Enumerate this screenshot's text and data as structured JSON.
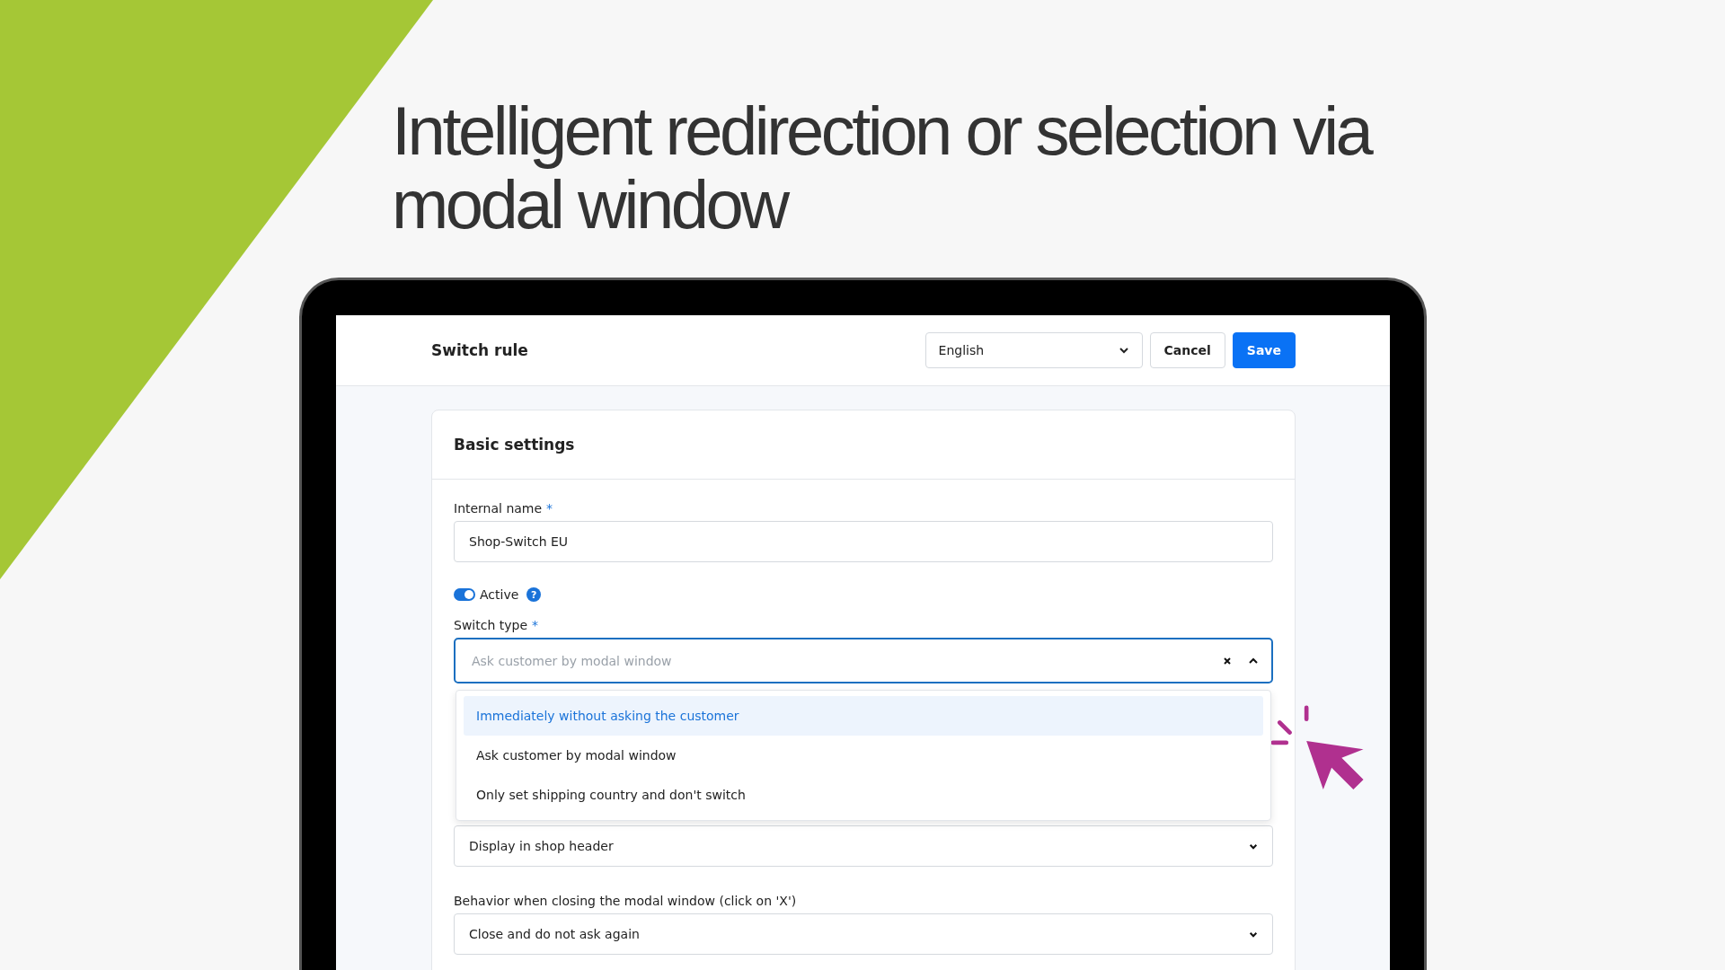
{
  "headline": "Intelligent redirection or selection via modal window",
  "app": {
    "title": "Switch rule",
    "language": "English",
    "buttons": [
      {
        "label": "Cancel",
        "kind": "secondary"
      },
      {
        "label": "Save",
        "kind": "primary"
      }
    ],
    "card": {
      "title": "Basic settings",
      "fields": [
        {
          "kind": "text",
          "label": "Internal name",
          "required_mark": "*",
          "value": "Shop-Switch EU"
        },
        {
          "kind": "toggle",
          "label": "Active",
          "on": true,
          "help": "?"
        },
        {
          "kind": "combobox",
          "label": "Switch type",
          "required_mark": "*",
          "placeholder": "Ask customer by modal window",
          "expanded": true,
          "options": [
            {
              "label": "Immediately without asking the customer",
              "selected": true
            },
            {
              "label": "Ask customer by modal window",
              "selected": false
            },
            {
              "label": "Only set shipping country and don't switch",
              "selected": false
            }
          ]
        },
        {
          "kind": "select",
          "value": "Display in shop header"
        },
        {
          "kind": "select",
          "label": "Behavior when closing the modal window (click on 'X')",
          "value": "Close and do not ask again"
        }
      ]
    }
  }
}
